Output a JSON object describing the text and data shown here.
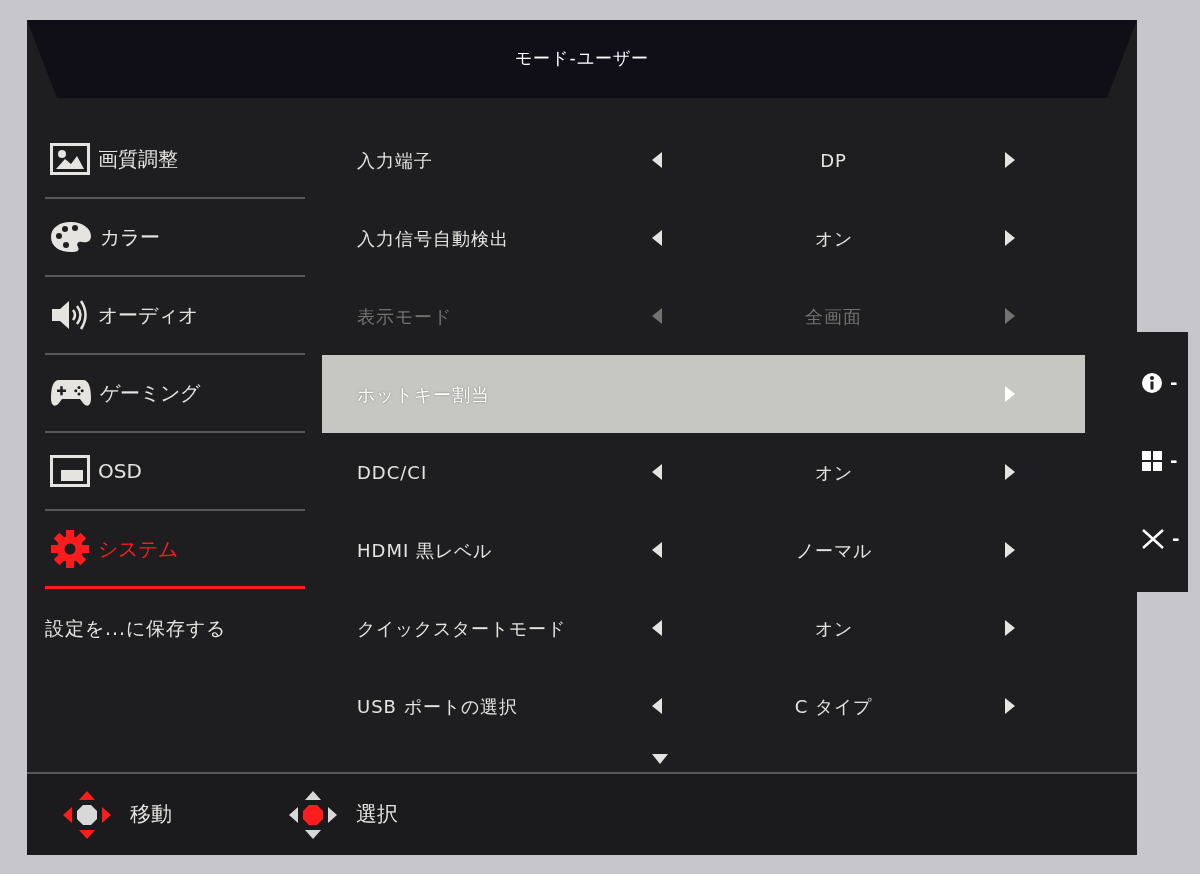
{
  "header": {
    "title": "モード-ユーザー"
  },
  "sidebar": {
    "items": [
      {
        "label": "画質調整",
        "selected": false
      },
      {
        "label": "カラー",
        "selected": false
      },
      {
        "label": "オーディオ",
        "selected": false
      },
      {
        "label": "ゲーミング",
        "selected": false
      },
      {
        "label": "OSD",
        "selected": false
      },
      {
        "label": "システム",
        "selected": true
      }
    ],
    "save_settings": "設定を...に保存する"
  },
  "settings": {
    "rows": [
      {
        "kind": "choice",
        "label": "入力端子",
        "value": "DP",
        "selected": false,
        "disabled": false
      },
      {
        "kind": "choice",
        "label": "入力信号自動検出",
        "value": "オン",
        "selected": false,
        "disabled": false
      },
      {
        "kind": "choice",
        "label": "表示モード",
        "value": "全画面",
        "selected": false,
        "disabled": true
      },
      {
        "kind": "submenu",
        "label": "ホットキー割当",
        "selected": true,
        "disabled": false
      },
      {
        "kind": "choice",
        "label": "DDC/CI",
        "value": "オン",
        "selected": false,
        "disabled": false
      },
      {
        "kind": "choice",
        "label": "HDMI 黒レベル",
        "value": "ノーマル",
        "selected": false,
        "disabled": false
      },
      {
        "kind": "choice",
        "label": "クイックスタートモード",
        "value": "オン",
        "selected": false,
        "disabled": false
      },
      {
        "kind": "choice",
        "label": "USB ポートの選択",
        "value": "C タイプ",
        "selected": false,
        "disabled": false
      }
    ]
  },
  "button_guide": [
    {
      "label": "-"
    },
    {
      "label": "-"
    },
    {
      "label": "-"
    }
  ],
  "footer": {
    "hints": [
      {
        "label": "移動"
      },
      {
        "label": "選択"
      }
    ]
  }
}
